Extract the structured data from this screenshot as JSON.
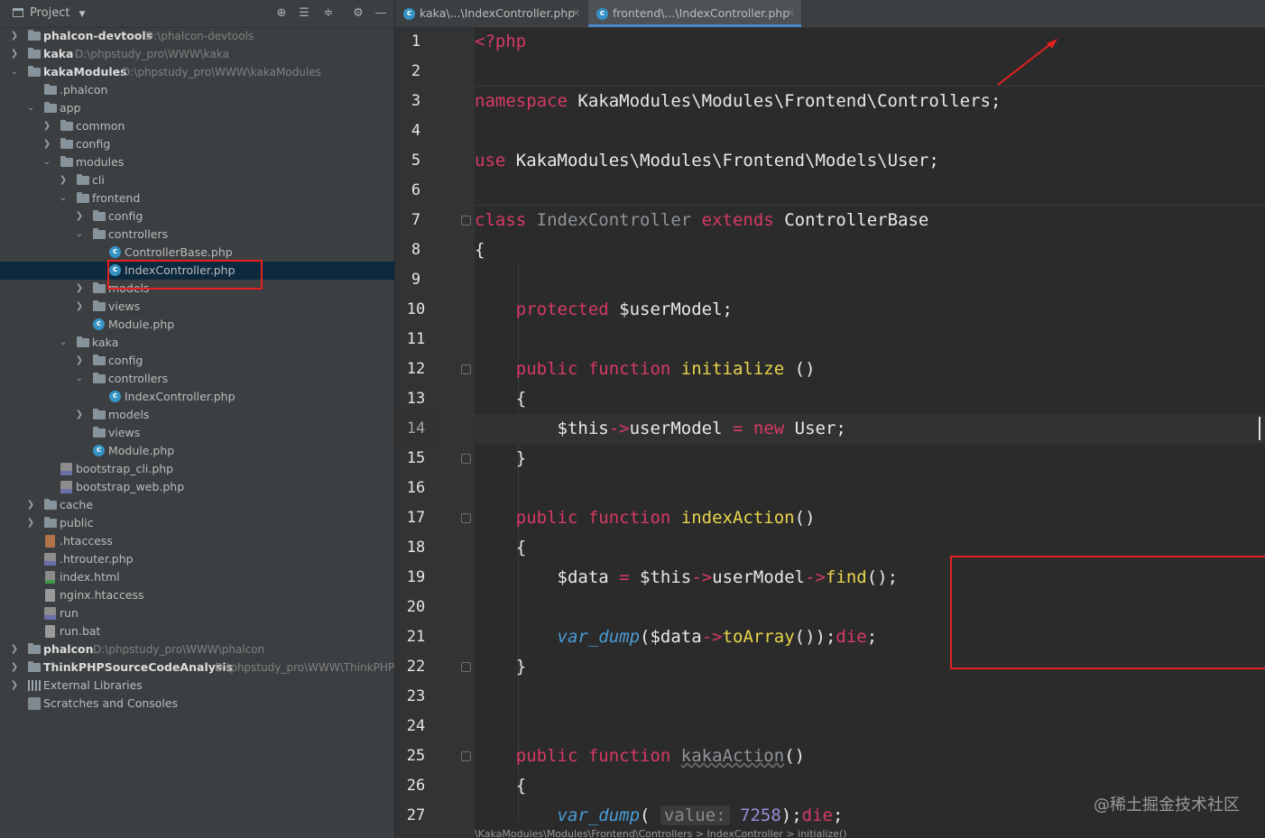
{
  "project_panel": {
    "title": "Project",
    "tree": [
      {
        "label": "phalcon-devtools",
        "path": "D:\\phalcon-devtools",
        "bold": true
      },
      {
        "label": "kaka",
        "path": "D:\\phpstudy_pro\\WWW\\kaka",
        "bold": true
      },
      {
        "label": "kakaModules",
        "path": "D:\\phpstudy_pro\\WWW\\kakaModules",
        "bold": true
      },
      {
        "label": ".phalcon"
      },
      {
        "label": "app"
      },
      {
        "label": "common"
      },
      {
        "label": "config"
      },
      {
        "label": "modules"
      },
      {
        "label": "cli"
      },
      {
        "label": "frontend"
      },
      {
        "label": "config"
      },
      {
        "label": "controllers"
      },
      {
        "label": "ControllerBase.php"
      },
      {
        "label": "IndexController.php"
      },
      {
        "label": "models"
      },
      {
        "label": "views"
      },
      {
        "label": "Module.php"
      },
      {
        "label": "kaka"
      },
      {
        "label": "config"
      },
      {
        "label": "controllers"
      },
      {
        "label": "IndexController.php"
      },
      {
        "label": "models"
      },
      {
        "label": "views"
      },
      {
        "label": "Module.php"
      },
      {
        "label": "bootstrap_cli.php"
      },
      {
        "label": "bootstrap_web.php"
      },
      {
        "label": "cache"
      },
      {
        "label": "public"
      },
      {
        "label": ".htaccess"
      },
      {
        "label": ".htrouter.php"
      },
      {
        "label": "index.html"
      },
      {
        "label": "nginx.htaccess"
      },
      {
        "label": "run"
      },
      {
        "label": "run.bat"
      },
      {
        "label": "phalcon",
        "path": "D:\\phpstudy_pro\\WWW\\phalcon",
        "bold": true
      },
      {
        "label": "ThinkPHPSourceCodeAnalysis",
        "path": "D:\\phpstudy_pro\\WWW\\ThinkPHP",
        "bold": true
      },
      {
        "label": "External Libraries"
      },
      {
        "label": "Scratches and Consoles"
      }
    ]
  },
  "editor": {
    "tabs": [
      {
        "label": "kaka\\...\\IndexController.php"
      },
      {
        "label": "frontend\\...\\IndexController.php"
      }
    ],
    "line_numbers": [
      "1",
      "2",
      "3",
      "4",
      "5",
      "6",
      "7",
      "8",
      "9",
      "10",
      "11",
      "12",
      "13",
      "14",
      "15",
      "16",
      "17",
      "18",
      "19",
      "20",
      "21",
      "22",
      "23",
      "24",
      "25",
      "26",
      "27"
    ],
    "code": {
      "l1": "<?php",
      "l3_kw": "namespace",
      "l3_rest": " KakaModules\\Modules\\Frontend\\Controllers;",
      "l5_kw": "use",
      "l5_rest": " KakaModules\\Modules\\Frontend\\Models\\User;",
      "l7_class": "class",
      "l7_name": " IndexController ",
      "l7_extends": "extends",
      "l7_base": " ControllerBase",
      "brace_open": "{",
      "brace_close": "}",
      "l10_kw": "protected",
      "l10_var": " $userModel;",
      "kw_public": "public",
      "kw_function": " function ",
      "l12_fn": "initialize",
      "l12_paren": " ()",
      "l14_this": "$this",
      "arrow": "->",
      "l14_prop": "userModel",
      "l14_eq": " = ",
      "l14_new": "new",
      "l14_user": " User;",
      "l17_fn": "indexAction",
      "parens": "()",
      "l19_data": "$data",
      "l19_eq": " = ",
      "l19_this": "$this",
      "l19_prop": "userModel",
      "l19_find": "find",
      "l19_end": "();",
      "l21_dump": "var_dump",
      "l21_open": "(",
      "l21_data": "$data",
      "l21_toarray": "toArray",
      "l21_close": "());",
      "kw_die": "die",
      "semicolon": ";",
      "l25_fn": "kakaAction",
      "l27_dump": "var_dump",
      "l27_open": "( ",
      "l27_hint": "value:",
      "l27_num": " 7258",
      "l27_close": ");"
    },
    "breadcrumb": "\\KakaModules\\Modules\\Frontend\\Controllers  >  IndexController  >  initialize()"
  },
  "watermark": "@稀土掘金技术社区"
}
